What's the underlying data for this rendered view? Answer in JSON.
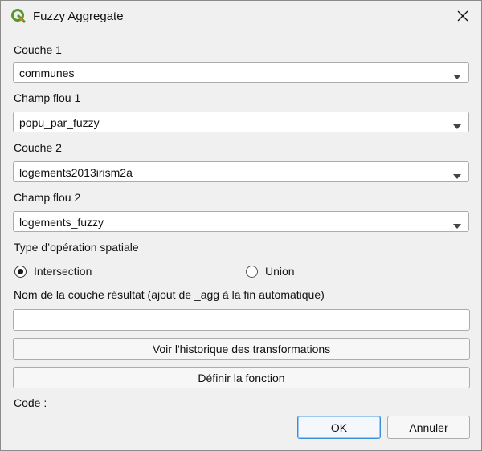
{
  "window": {
    "title": "Fuzzy Aggregate",
    "app_icon": "qgis-logo-icon",
    "close_icon": "close-icon"
  },
  "form": {
    "layer1": {
      "label": "Couche 1",
      "value": "communes"
    },
    "field1": {
      "label": "Champ flou 1",
      "value": "popu_par_fuzzy"
    },
    "layer2": {
      "label": "Couche 2",
      "value": "logements2013irism2a"
    },
    "field2": {
      "label": "Champ flou 2",
      "value": "logements_fuzzy"
    },
    "operation": {
      "label": "Type d’opération spatiale",
      "options": [
        {
          "label": "Intersection",
          "selected": true
        },
        {
          "label": "Union",
          "selected": false
        }
      ]
    },
    "output": {
      "label": "Nom de la couche résultat (ajout de _agg à la fin automatique)",
      "value": ""
    },
    "history_button": "Voir l'historique des transformations",
    "function_button": "Définir la fonction",
    "code_label": "Code :"
  },
  "buttons": {
    "ok": "OK",
    "cancel": "Annuler"
  },
  "colors": {
    "qgis_green": "#589632",
    "qgis_yellow": "#ee7913",
    "default_button_border": "#3b8fd8"
  }
}
